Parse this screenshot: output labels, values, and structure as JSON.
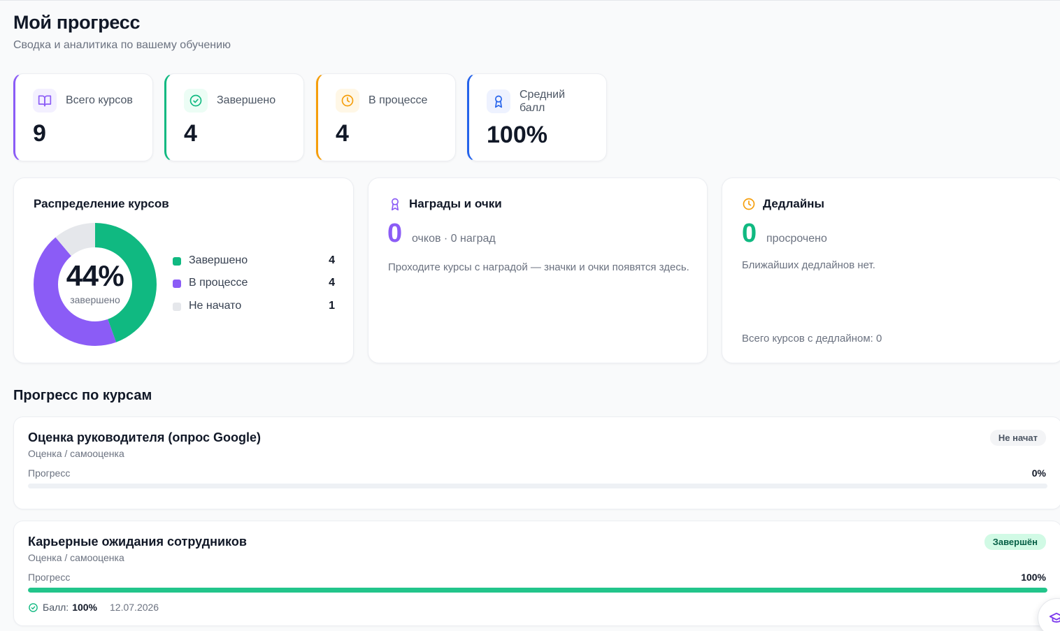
{
  "header": {
    "title": "Мой прогресс",
    "subtitle": "Сводка и аналитика по вашему обучению"
  },
  "colors": {
    "completed": "#10b981",
    "in_progress": "#8b5cf6",
    "not_started": "#e5e7eb",
    "purple": "#8b5cf6",
    "green": "#10b981",
    "orange": "#f59e0b",
    "blue": "#2563eb"
  },
  "stats": [
    {
      "label": "Всего курсов",
      "value": "9",
      "icon": "book-icon"
    },
    {
      "label": "Завершено",
      "value": "4",
      "icon": "check-circle-icon"
    },
    {
      "label": "В процессе",
      "value": "4",
      "icon": "clock-icon"
    },
    {
      "label": "Средний балл",
      "value": "100%",
      "icon": "award-icon"
    }
  ],
  "distribution": {
    "title": "Распределение курсов",
    "percent": "44%",
    "percent_label": "завершено",
    "legend": [
      {
        "label": "Завершено",
        "count": "4"
      },
      {
        "label": "В процессе",
        "count": "4"
      },
      {
        "label": "Не начато",
        "count": "1"
      }
    ]
  },
  "chart_data": {
    "type": "pie",
    "categories": [
      "Завершено",
      "В процессе",
      "Не начато"
    ],
    "values": [
      4,
      4,
      1
    ]
  },
  "rewards": {
    "title": "Награды и очки",
    "value": "0",
    "sub": "очков · 0 наград",
    "text": "Проходите курсы с наградой — значки и очки появятся здесь."
  },
  "deadlines": {
    "title": "Дедлайны",
    "value": "0",
    "sub": "просрочено",
    "text": "Ближайших дедлайнов нет.",
    "footer": "Всего курсов с дедлайном: 0"
  },
  "courses_section": {
    "title": "Прогресс по курсам",
    "progress_label": "Прогресс",
    "score_label": "Балл:",
    "courses": [
      {
        "title": "Оценка руководителя (опрос Google)",
        "category": "Оценка / самооценка",
        "status": "Не начат",
        "progress": 0,
        "progress_text": "0%"
      },
      {
        "title": "Карьерные ожидания сотрудников",
        "category": "Оценка / самооценка",
        "status": "Завершён",
        "progress": 100,
        "progress_text": "100%",
        "score": "100%",
        "date": "12.07.2026"
      }
    ]
  }
}
